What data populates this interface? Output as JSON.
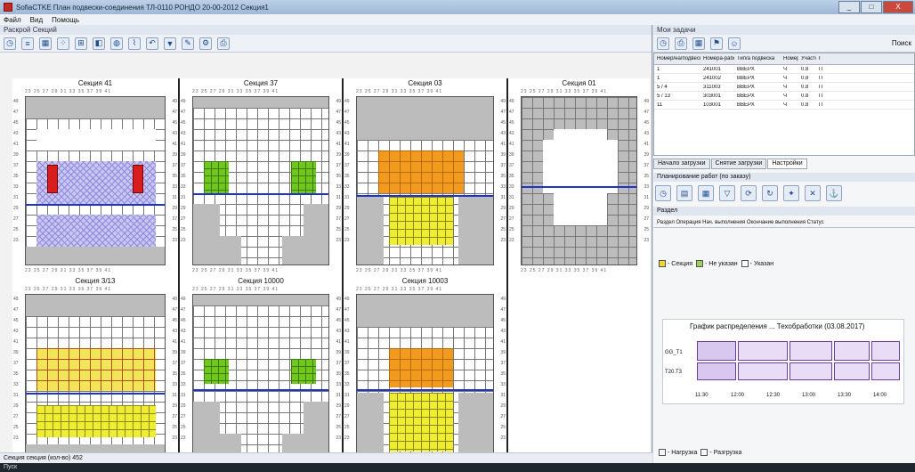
{
  "window": {
    "title": "SofiaCTKE План подвески-соединения ТЛ-0110 РОНДО 20-00-2012 Секция1",
    "min": "_",
    "max": "□",
    "close": "X"
  },
  "menu": [
    "Файл",
    "Вид",
    "Помощь"
  ],
  "left_panel": {
    "title": "Раскрой Секций",
    "status": "Секция секция (кол-во) 452"
  },
  "sections": [
    {
      "name": "Секция 41"
    },
    {
      "name": "Секция 37"
    },
    {
      "name": "Секция 03"
    },
    {
      "name": "Секция 01"
    },
    {
      "name": "Секция 3/13"
    },
    {
      "name": "Секция 10000"
    },
    {
      "name": "Секция 10003"
    }
  ],
  "ruler_text": "23 25 27 29 31 33 35 37 39 41",
  "side_text": "49 47 45 43 41 39 37 35 33 31 29 27 25 23",
  "right_panel": {
    "title": "Мои задачи",
    "search_label": "Поиск",
    "table_headers": [
      "Номер/на/подвеска",
      "Номера-рабочих",
      "Тип/а подвеска",
      "Номер",
      "Участок",
      "Г"
    ],
    "table_rows": [
      [
        "1",
        "241001",
        "ВВЕРХ",
        "Ч",
        "0.8",
        "П"
      ],
      [
        "1",
        "241002",
        "ВВЕРХ",
        "Ч",
        "0.8",
        "П"
      ],
      [
        "5 / 4",
        "311003",
        "ВВЕРХ",
        "Ч",
        "0.8",
        "П"
      ],
      [
        "5 / 13",
        "303001",
        "ВВЕРХ",
        "Ч",
        "0.8",
        "П"
      ],
      [
        "11",
        "103001",
        "ВВЕРХ",
        "Ч",
        "0.8",
        "П"
      ]
    ],
    "tabs": [
      "Начало загрузки",
      "Снятие загрузки",
      "Настройки"
    ],
    "sub1": "Планирование работ (по заказу)",
    "sub2": "Раздел",
    "columns_text": "Раздел  Операция  Нач. выполнения  Окончание выполнения  Статус",
    "legend": [
      "- Секция",
      "- Не указан",
      "- Указан"
    ],
    "chart_title": "График распределения ... Техобработки (03.08.2017)",
    "chart_rows": [
      "GG_Т1",
      "Т20.Т3"
    ],
    "chart_ticks": [
      "11:30",
      "12:00",
      "12:30",
      "13:00",
      "13:30",
      "14:00"
    ],
    "foot_legend": [
      "- Нагрузка",
      "- Разгрузка"
    ]
  },
  "taskbar": "Пуск"
}
